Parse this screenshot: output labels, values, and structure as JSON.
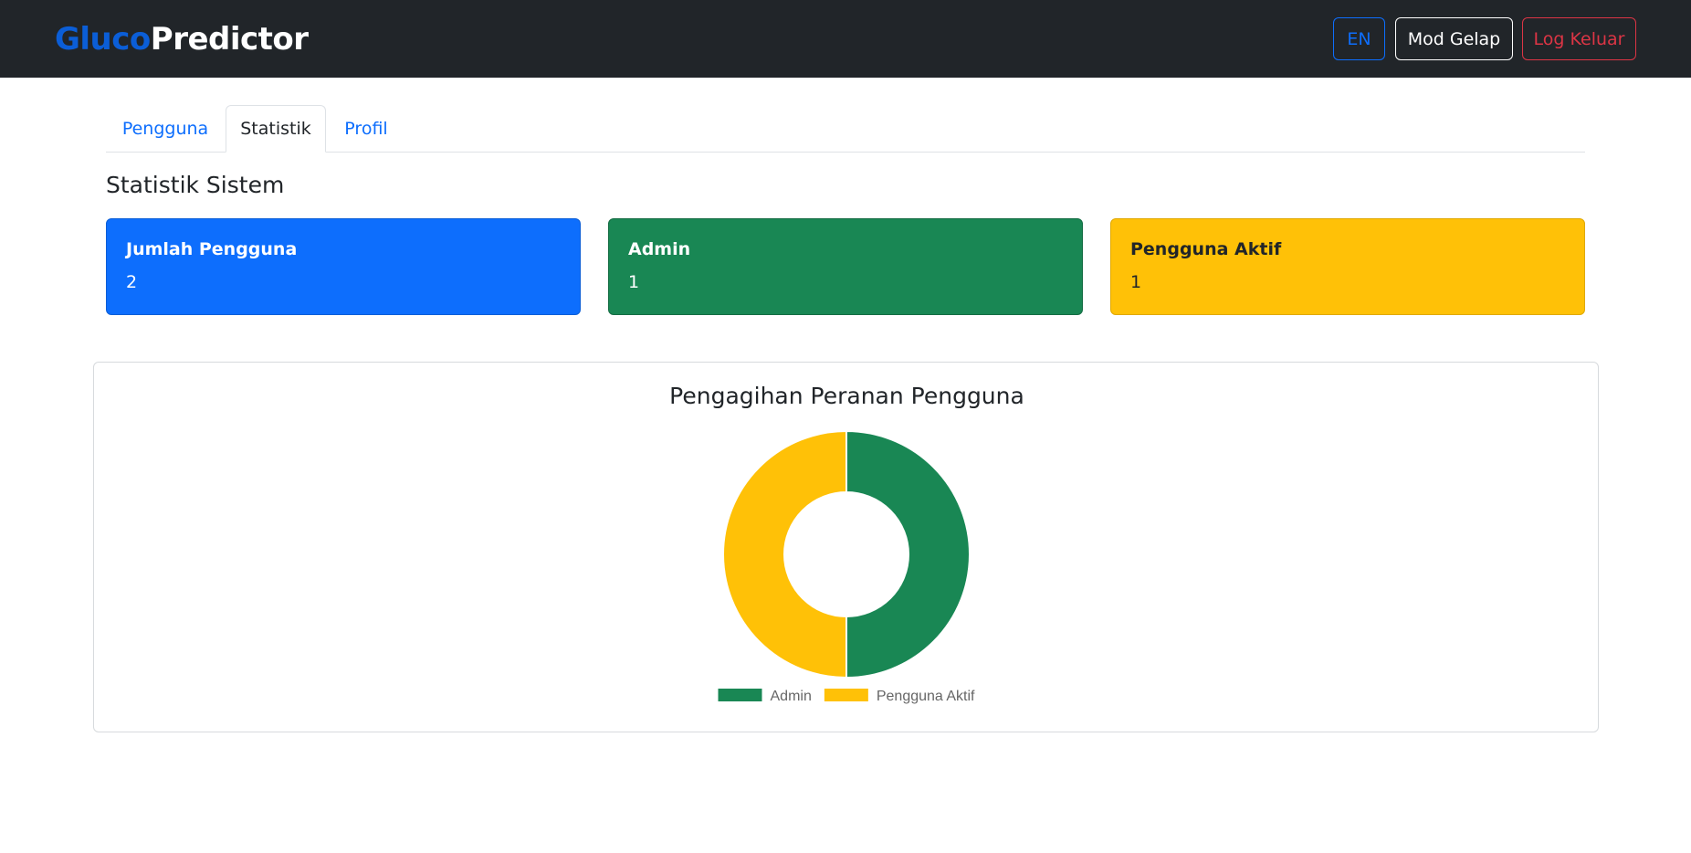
{
  "header": {
    "brand_part1": "Gluco",
    "brand_part2": "Predictor",
    "lang_button": "EN",
    "dark_mode_button": "Mod Gelap",
    "logout_button": "Log Keluar"
  },
  "tabs": [
    {
      "label": "Pengguna",
      "active": false
    },
    {
      "label": "Statistik",
      "active": true
    },
    {
      "label": "Profil",
      "active": false
    }
  ],
  "section_title": "Statistik Sistem",
  "stats": [
    {
      "label": "Jumlah Pengguna",
      "value": "2",
      "color": "#0d6efd"
    },
    {
      "label": "Admin",
      "value": "1",
      "color": "#198754"
    },
    {
      "label": "Pengguna Aktif",
      "value": "1",
      "color": "#ffc107"
    }
  ],
  "chart_data": {
    "type": "pie",
    "variant": "doughnut",
    "title": "Pengagihan Peranan Pengguna",
    "categories": [
      "Admin",
      "Pengguna Aktif"
    ],
    "values": [
      1,
      1
    ],
    "colors": [
      "#198754",
      "#ffc107"
    ],
    "legend": "bottom"
  }
}
